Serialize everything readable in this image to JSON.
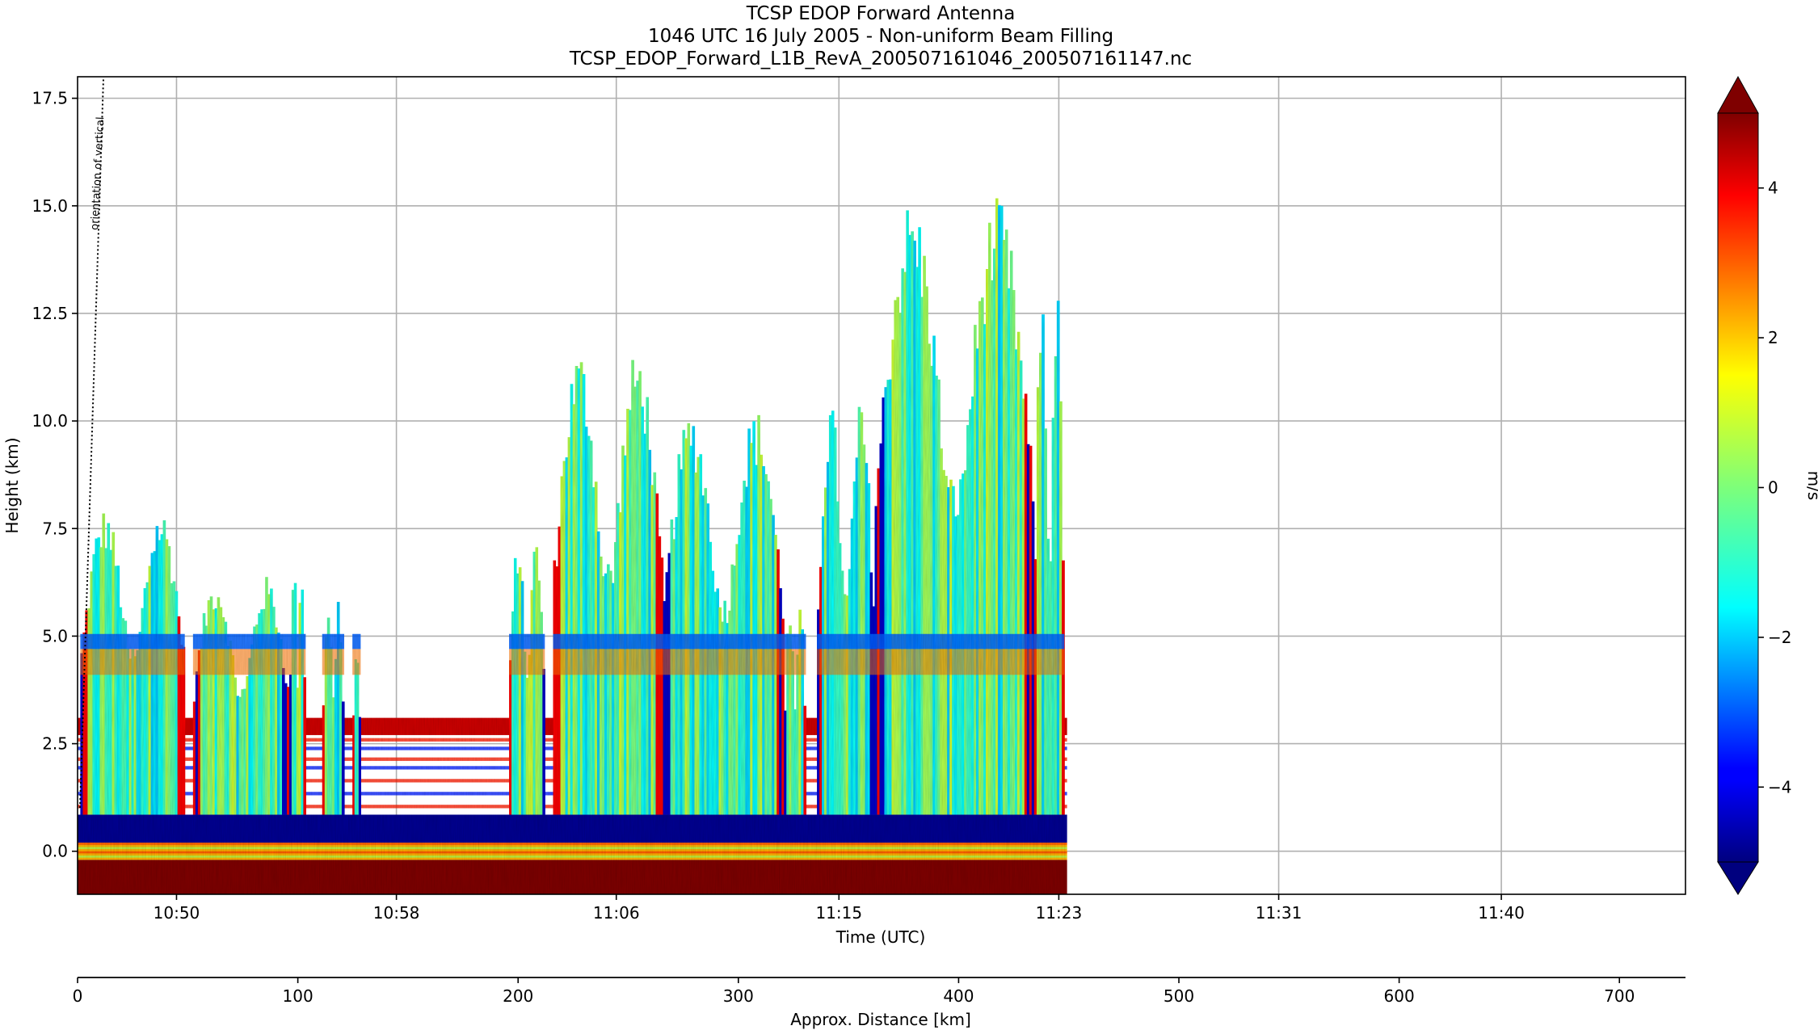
{
  "chart_data": {
    "type": "heatmap",
    "title_lines": [
      "TCSP EDOP Forward Antenna",
      "1046 UTC 16 July 2005 - Non-uniform Beam Filling",
      "TCSP_EDOP_Forward_L1B_RevA_200507161046_200507161147.nc"
    ],
    "xlabel": "Time (UTC)",
    "ylabel": "Height (km)",
    "x_tick_labels": [
      "10:50",
      "10:58",
      "11:06",
      "11:15",
      "11:23",
      "11:31",
      "11:40"
    ],
    "x_tick_minutes": [
      49.6,
      57.6,
      65.6,
      73.7,
      81.7,
      89.7,
      97.8
    ],
    "xlim_minutes": [
      46.0,
      104.5
    ],
    "y_ticks": [
      0.0,
      2.5,
      5.0,
      7.5,
      10.0,
      12.5,
      15.0,
      17.5
    ],
    "y_tick_labels": [
      "0.0",
      "2.5",
      "5.0",
      "7.5",
      "10.0",
      "12.5",
      "15.0",
      "17.5"
    ],
    "ylim": [
      -1.0,
      18.0
    ],
    "grid": true,
    "colorbar": {
      "label": "m/s",
      "range": [
        -5,
        5
      ],
      "ticks": [
        4,
        2,
        0,
        -2,
        -4
      ],
      "tick_labels": [
        "4",
        "2",
        "0",
        "−2",
        "−4"
      ],
      "extend": "both",
      "colormap": "jet"
    },
    "secondary_axis": {
      "label": "Approx. Distance [km]",
      "ticks": [
        0,
        100,
        200,
        300,
        400,
        500,
        600,
        700
      ],
      "tick_labels": [
        "0",
        "100",
        "200",
        "300",
        "400",
        "500",
        "600",
        "700"
      ],
      "range": [
        0,
        730
      ]
    },
    "annotation": "orientation of vertical",
    "data_end_minutes": 82.0,
    "echo_columns": [
      {
        "t0": 46.1,
        "t1": 49.9,
        "top_km": 8.0
      },
      {
        "t0": 50.2,
        "t1": 53.7,
        "top_km": 6.4
      },
      {
        "t0": 53.7,
        "t1": 54.3,
        "top_km": 7.0
      },
      {
        "t0": 54.9,
        "t1": 55.7,
        "top_km": 6.0
      },
      {
        "t0": 56.0,
        "t1": 56.3,
        "top_km": 5.2
      },
      {
        "t0": 61.7,
        "t1": 63.0,
        "top_km": 7.4
      },
      {
        "t0": 63.3,
        "t1": 67.3,
        "top_km": 11.7
      },
      {
        "t0": 67.3,
        "t1": 71.7,
        "top_km": 10.3
      },
      {
        "t0": 71.7,
        "t1": 72.5,
        "top_km": 5.7
      },
      {
        "t0": 72.9,
        "t1": 75.0,
        "top_km": 10.5
      },
      {
        "t0": 75.0,
        "t1": 80.8,
        "top_km": 15.2
      },
      {
        "t0": 80.8,
        "t1": 81.9,
        "top_km": 13.2
      }
    ],
    "layers": [
      {
        "name": "surface",
        "h0_km": -1.0,
        "h1_km": -0.2,
        "value": 5.0
      },
      {
        "name": "near-surface",
        "h0_km": -0.2,
        "h1_km": 0.2,
        "value": 2.0
      },
      {
        "name": "sidelobe",
        "h0_km": 0.2,
        "h1_km": 0.85,
        "value": -4.8
      },
      {
        "name": "melting-band",
        "h0_km": 2.7,
        "h1_km": 3.1,
        "value": 4.2
      },
      {
        "name": "bright-band-5km",
        "h0_km": 4.7,
        "h1_km": 5.05,
        "value": -2.8
      }
    ],
    "colors": {
      "grid": "#b0b0b0",
      "surface": "#800000",
      "sidelobe": "#00008f"
    }
  }
}
